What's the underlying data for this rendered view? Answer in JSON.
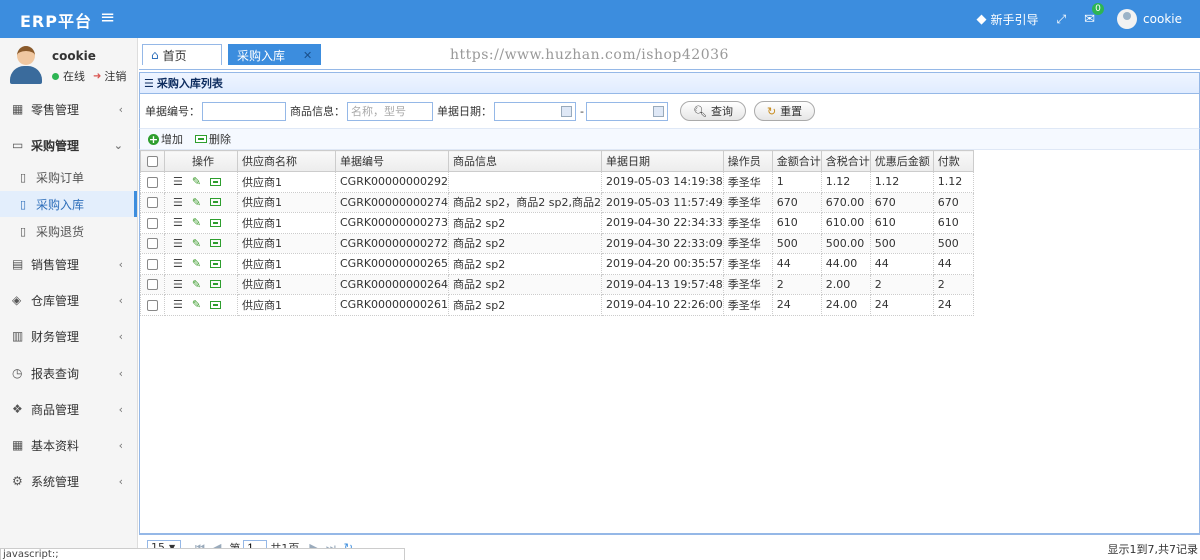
{
  "header": {
    "brand": "ERP平台",
    "guide_label": "新手引导",
    "message_count": "0",
    "username": "cookie",
    "color": "#3c8dde"
  },
  "user": {
    "name": "cookie",
    "status": "在线",
    "logout": "注销"
  },
  "sidebar": {
    "items": [
      {
        "label": "零售管理",
        "icon": "store-icon"
      },
      {
        "label": "采购管理",
        "icon": "monitor-icon",
        "open": true,
        "children": [
          {
            "label": "采购订单"
          },
          {
            "label": "采购入库",
            "active": true
          },
          {
            "label": "采购退货"
          }
        ]
      },
      {
        "label": "销售管理",
        "icon": "sales-icon"
      },
      {
        "label": "仓库管理",
        "icon": "layers-icon"
      },
      {
        "label": "财务管理",
        "icon": "book-icon"
      },
      {
        "label": "报表查询",
        "icon": "clock-icon"
      },
      {
        "label": "商品管理",
        "icon": "cubes-icon"
      },
      {
        "label": "基本资料",
        "icon": "grid-icon"
      },
      {
        "label": "系统管理",
        "icon": "gear-icon"
      }
    ]
  },
  "tabs": [
    {
      "label": "首页"
    },
    {
      "label": "采购入库"
    }
  ],
  "watermark": "https://www.huzhan.com/ishop42036",
  "panel": {
    "title": "采购入库列表",
    "search": {
      "number_label": "单据编号：",
      "product_label": "商品信息：",
      "product_placeholder": "名称，型号",
      "date_label": "单据日期：",
      "date_sep": "-",
      "query_label": "查询",
      "reset_label": "重置"
    },
    "toolbar": {
      "add_label": "增加",
      "delete_label": "删除"
    },
    "table": {
      "columns": [
        "操作",
        "供应商名称",
        "单据编号",
        "商品信息",
        "单据日期",
        "操作员",
        "金额合计",
        "含税合计",
        "优惠后金额",
        "付款"
      ],
      "rows": [
        [
          "供应商1",
          "CGRK00000000292",
          "",
          "2019-05-03 14:19:38",
          "季圣华",
          "1",
          "1.12",
          "1.12",
          "1.12"
        ],
        [
          "供应商1",
          "CGRK00000000274",
          "商品2 sp2，商品2 sp2,商品2",
          "2019-05-03 11:57:49",
          "季圣华",
          "670",
          "670.00",
          "670",
          "670"
        ],
        [
          "供应商1",
          "CGRK00000000273",
          "商品2 sp2",
          "2019-04-30 22:34:33",
          "季圣华",
          "610",
          "610.00",
          "610",
          "610"
        ],
        [
          "供应商1",
          "CGRK00000000272",
          "商品2 sp2",
          "2019-04-30 22:33:09",
          "季圣华",
          "500",
          "500.00",
          "500",
          "500"
        ],
        [
          "供应商1",
          "CGRK00000000265",
          "商品2 sp2",
          "2019-04-20 00:35:57",
          "季圣华",
          "44",
          "44.00",
          "44",
          "44"
        ],
        [
          "供应商1",
          "CGRK00000000264",
          "商品2 sp2",
          "2019-04-13 19:57:48",
          "季圣华",
          "2",
          "2.00",
          "2",
          "2"
        ],
        [
          "供应商1",
          "CGRK00000000261",
          "商品2 sp2",
          "2019-04-10 22:26:00",
          "季圣华",
          "24",
          "24.00",
          "24",
          "24"
        ]
      ]
    },
    "pager": {
      "page_size": "15",
      "page_prefix": "第",
      "page_value": "1",
      "page_suffix": "共1页",
      "info": "显示1到7,共7记录"
    }
  },
  "statusbar": "javascript:;"
}
